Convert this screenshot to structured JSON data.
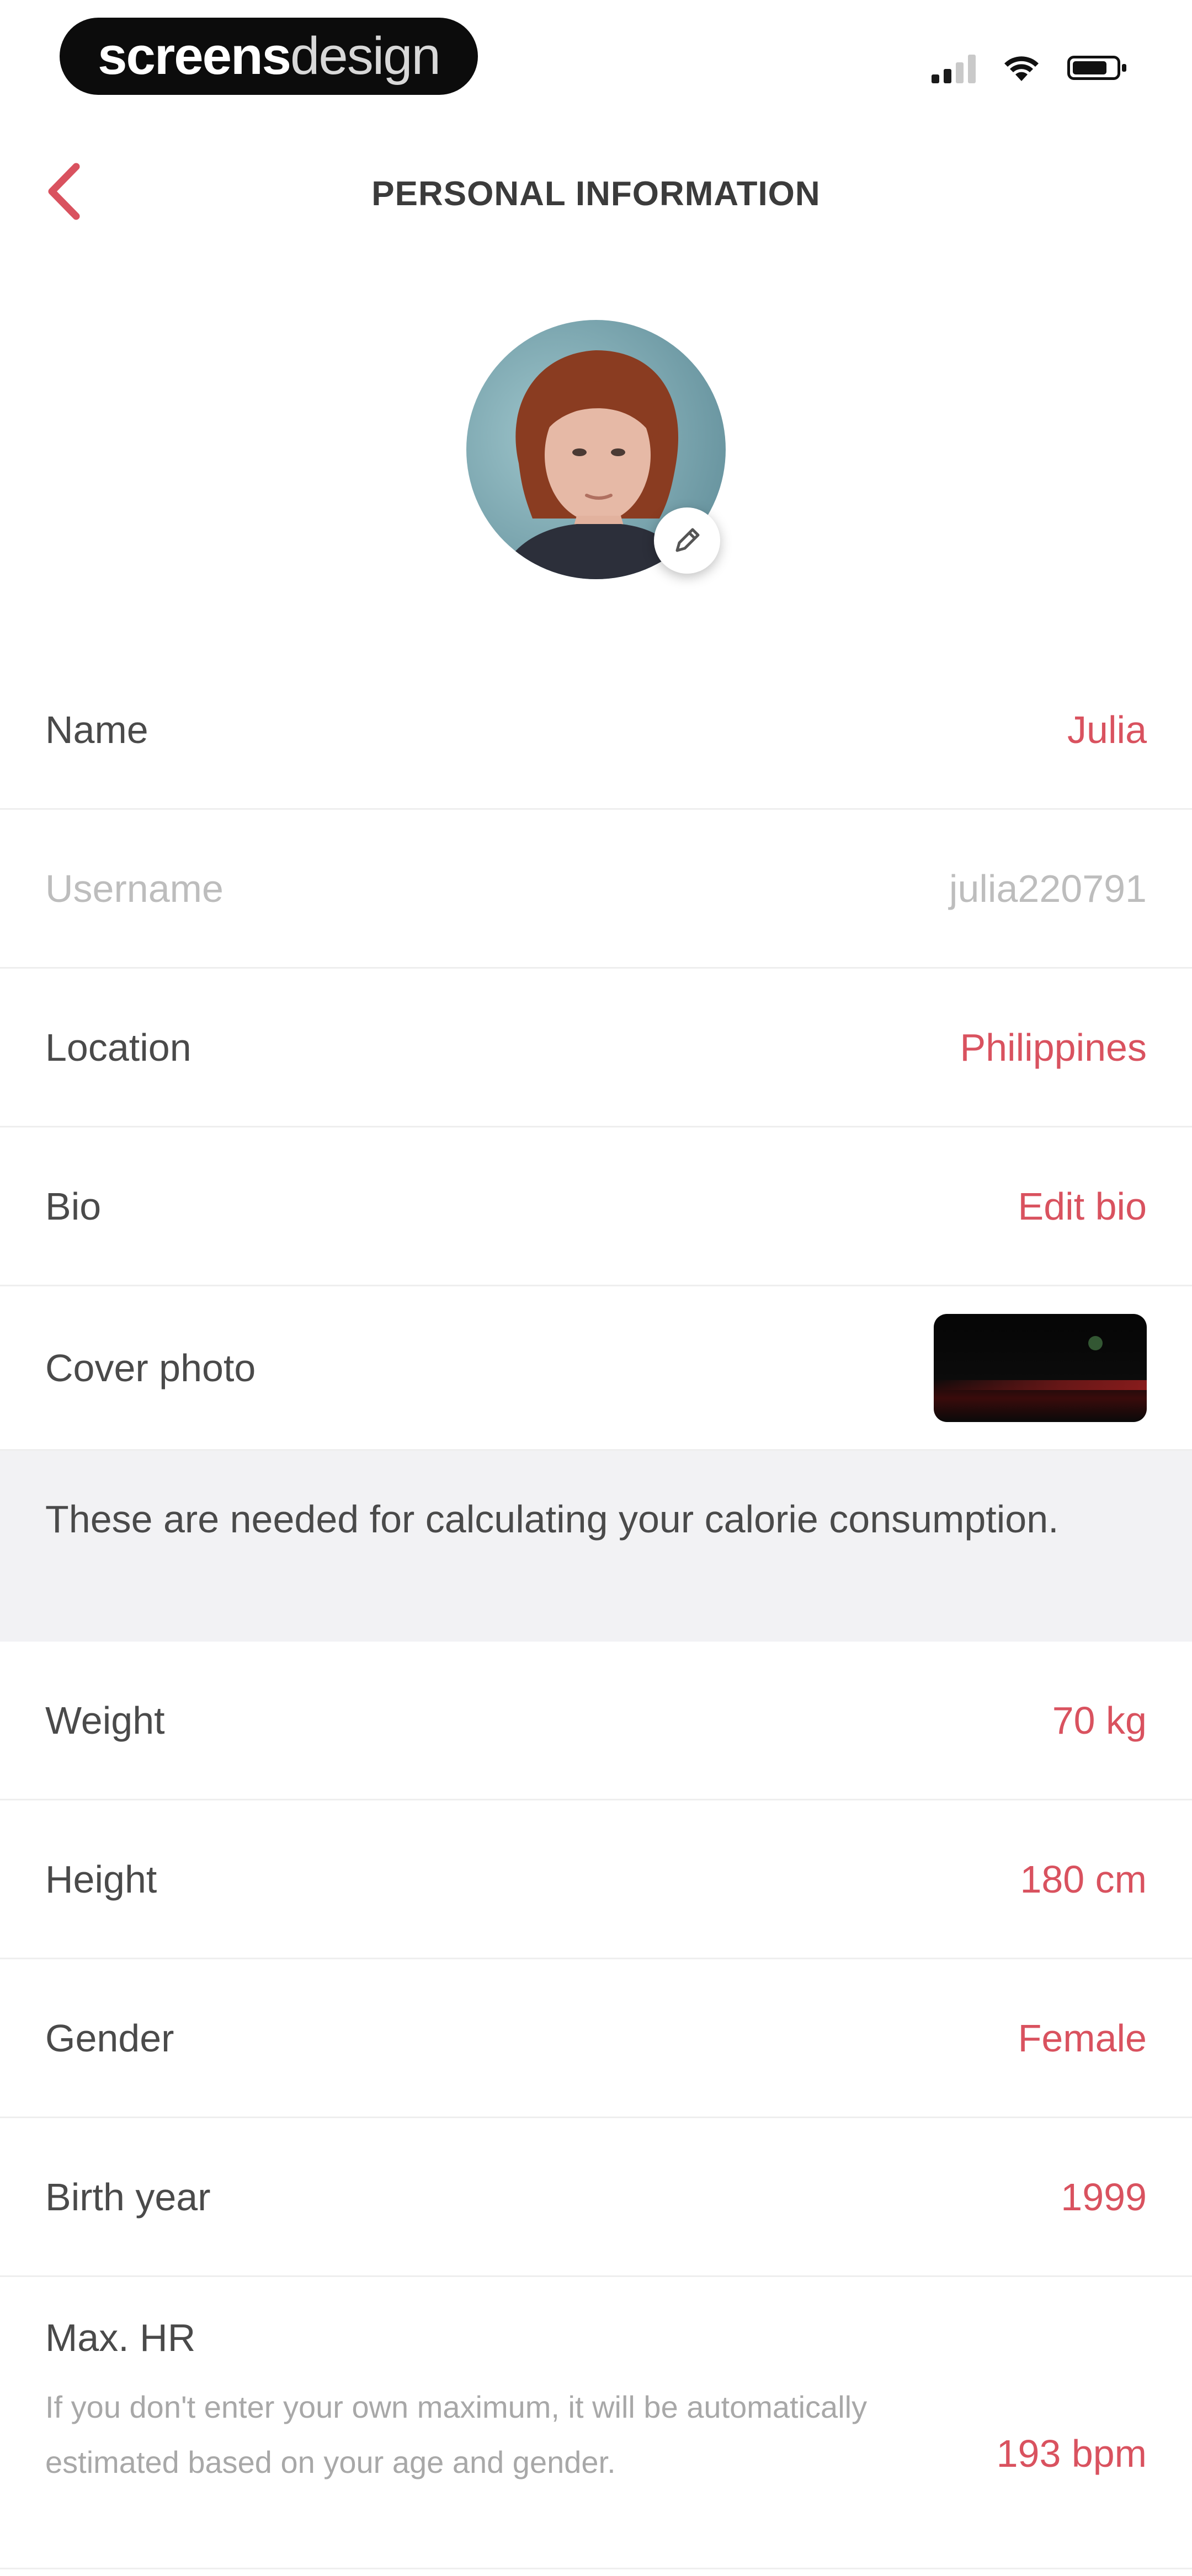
{
  "status_bar": {
    "brand_part1": "screens",
    "brand_part2": "design",
    "signal_icon": "cellular-signal-icon",
    "wifi_icon": "wifi-icon",
    "battery_icon": "battery-icon",
    "battery_level": 0.8
  },
  "nav": {
    "title": "PERSONAL INFORMATION",
    "back_icon": "chevron-left-icon"
  },
  "profile": {
    "edit_icon": "pencil-icon"
  },
  "rows": [
    {
      "label": "Name",
      "value": "Julia"
    },
    {
      "label": "Username",
      "value": "julia220791"
    },
    {
      "label": "Location",
      "value": "Philippines"
    },
    {
      "label": "Bio",
      "value": "Edit bio"
    },
    {
      "label": "Cover photo"
    }
  ],
  "info_band": "These are needed for calculating your calorie consumption.",
  "body_rows": [
    {
      "label": "Weight",
      "value": "70 kg"
    },
    {
      "label": "Height",
      "value": "180 cm"
    },
    {
      "label": "Gender",
      "value": "Female"
    },
    {
      "label": "Birth year",
      "value": "1999"
    }
  ],
  "max_hr": {
    "label": "Max. HR",
    "description": "If you don't enter your own maximum, it will be automatically estimated based on your age and gender.",
    "value": "193 bpm"
  },
  "colors": {
    "accent": "#d9525f",
    "text": "#4a4a4a",
    "muted": "#bdbdbd",
    "band": "#f2f2f4"
  }
}
